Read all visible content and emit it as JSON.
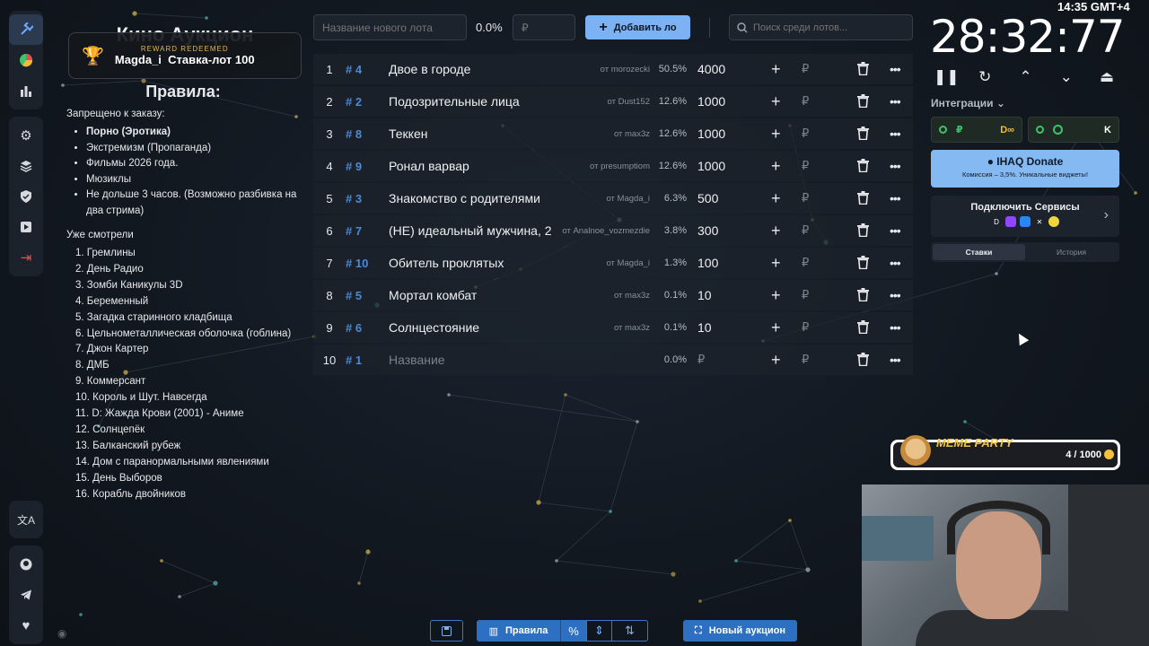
{
  "app": {
    "title": "Кино Аукцион"
  },
  "reward": {
    "label": "REWARD REDEEMED",
    "user": "Magda_i",
    "item": "Ставка-лот 100",
    "text": "Magda_i  Ставка-лот 100"
  },
  "rules": {
    "heading": "Правила:",
    "forbidden_label": "Запрещено к заказу:",
    "forbidden": [
      "Порно (Эротика)",
      "Экстремизм (Пропаганда)",
      "Фильмы 2026 года.",
      "Мюзиклы",
      "Не дольше 3 часов. (Возможно разбивка на два стрима)"
    ],
    "watched_label": "Уже смотрели",
    "watched": [
      "1. Гремлины",
      "2. День Радио",
      "3. Зомби Каникулы 3D",
      "4. Беременный",
      "5. Загадка старинного кладбища",
      "6. Цельнометаллическая оболочка (гоблина)",
      "7. Джон Картер",
      "8. ДМБ",
      "9. Коммерсант",
      "10. Король и Шут. Навсегда",
      "11. D: Жажда Крови (2001) - Аниме",
      "12. Солнцепёк",
      "13. Балканский рубеж",
      "14. Дом с паранормальными явлениями",
      "15. День Выборов",
      "16. Корабль двойников"
    ]
  },
  "toolbar": {
    "lot_placeholder": "Название нового лота",
    "percent": "0.0%",
    "price_placeholder": "₽",
    "add_label": "Добавить ло",
    "search_placeholder": "Поиск среди лотов..."
  },
  "lots": [
    {
      "num": "1",
      "id": "# 4",
      "name": "Двое в городе",
      "from": "от morozecki",
      "pct": "50.5%",
      "amount": "4000"
    },
    {
      "num": "2",
      "id": "# 2",
      "name": "Подозрительные лица",
      "from": "от Dust152",
      "pct": "12.6%",
      "amount": "1000"
    },
    {
      "num": "3",
      "id": "# 8",
      "name": "Теккен",
      "from": "от max3z",
      "pct": "12.6%",
      "amount": "1000"
    },
    {
      "num": "4",
      "id": "# 9",
      "name": "Ронал варвар",
      "from": "от presumptiom",
      "pct": "12.6%",
      "amount": "1000"
    },
    {
      "num": "5",
      "id": "# 3",
      "name": "Знакомство с родителями",
      "from": "от Magda_i",
      "pct": "6.3%",
      "amount": "500"
    },
    {
      "num": "6",
      "id": "# 7",
      "name": "(НЕ) идеальный мужчина, 2",
      "from": "от Analnoe_vozmezdie",
      "pct": "3.8%",
      "amount": "300"
    },
    {
      "num": "7",
      "id": "# 10",
      "name": "Обитель проклятых",
      "from": "от Magda_i",
      "pct": "1.3%",
      "amount": "100"
    },
    {
      "num": "8",
      "id": "# 5",
      "name": "Мортал комбат",
      "from": "от max3z",
      "pct": "0.1%",
      "amount": "10"
    },
    {
      "num": "9",
      "id": "# 6",
      "name": "Солнцестояние",
      "from": "от max3z",
      "pct": "0.1%",
      "amount": "10"
    },
    {
      "num": "10",
      "id": "# 1",
      "name": "Название",
      "from": "",
      "pct": "0.0%",
      "amount": "₽"
    }
  ],
  "rub_sign": "₽",
  "right": {
    "clock": "14:35 GMT+4",
    "timer": "28:32:77",
    "integrations_label": "Интеграции",
    "ihaq_title": "IHAQ Donate",
    "ihaq_sub": "Комиссия – 3,5%. Уникальные виджеты!",
    "connect_title": "Подключить Сервисы",
    "tab_bets": "Ставки",
    "tab_history": "История",
    "card1_a": "₽",
    "card1_b": "D∞",
    "card2_b": "K"
  },
  "meme": {
    "title": "MEME PARTY",
    "count": "4 / 1000"
  },
  "bottom": {
    "rules_label": "Правила",
    "percent_icon": "%",
    "new_auction": "Новый аукцион"
  },
  "colors": {
    "accent": "#7cb2f4",
    "primary": "#2d6fc0",
    "id_blue": "#4a8ad8"
  }
}
